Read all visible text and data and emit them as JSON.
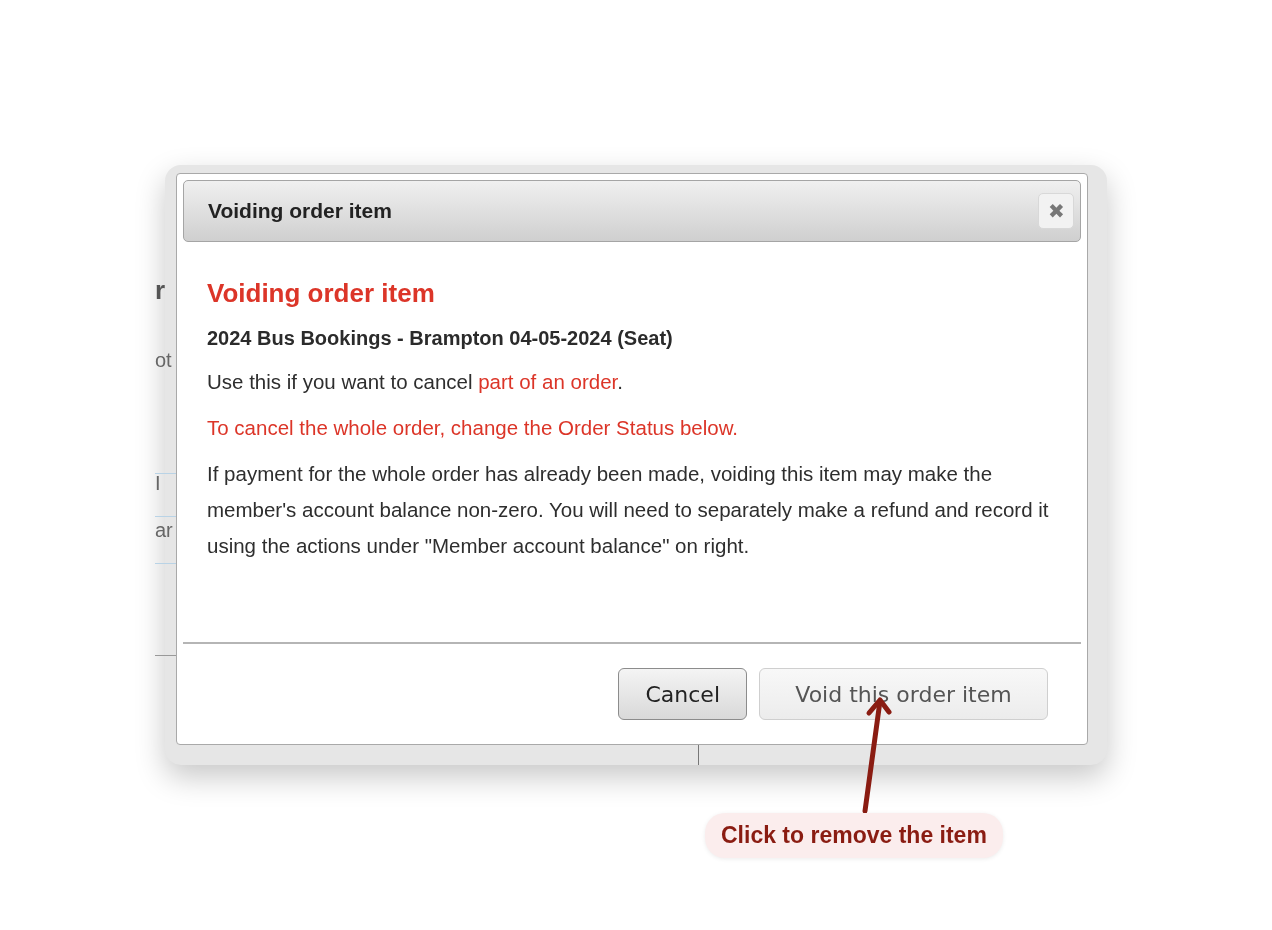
{
  "background_page": {
    "fragments": [
      {
        "text": "r",
        "kind": "heading"
      },
      {
        "text": "ot",
        "kind": "text"
      },
      {
        "text": "I",
        "kind": "text"
      },
      {
        "text": "ar",
        "kind": "text"
      }
    ]
  },
  "dialog": {
    "title": "Voiding order item",
    "close_label": "✖",
    "heading": "Voiding order item",
    "item_name": "2024 Bus Bookings - Brampton 04-05-2024 (Seat)",
    "paragraphs": [
      {
        "kind": "mixed",
        "parts": [
          {
            "text": "Use this if you want to cancel ",
            "highlight": false
          },
          {
            "text": "part of an order",
            "highlight": true
          },
          {
            "text": ".",
            "highlight": false
          }
        ]
      },
      {
        "text": "To cancel the whole order, change the Order Status below.",
        "kind": "warning"
      },
      {
        "text": "If payment for the whole order has already been made, voiding this item may make the member's account balance non-zero. You will need to separately make a refund and record it using the actions under \"Member account balance\" on right.",
        "kind": "normal"
      }
    ],
    "buttons": [
      {
        "label": "Cancel",
        "disabled": false
      },
      {
        "label": "Void this order item",
        "disabled": true
      }
    ]
  },
  "callout": {
    "text": "Click to remove the item"
  }
}
